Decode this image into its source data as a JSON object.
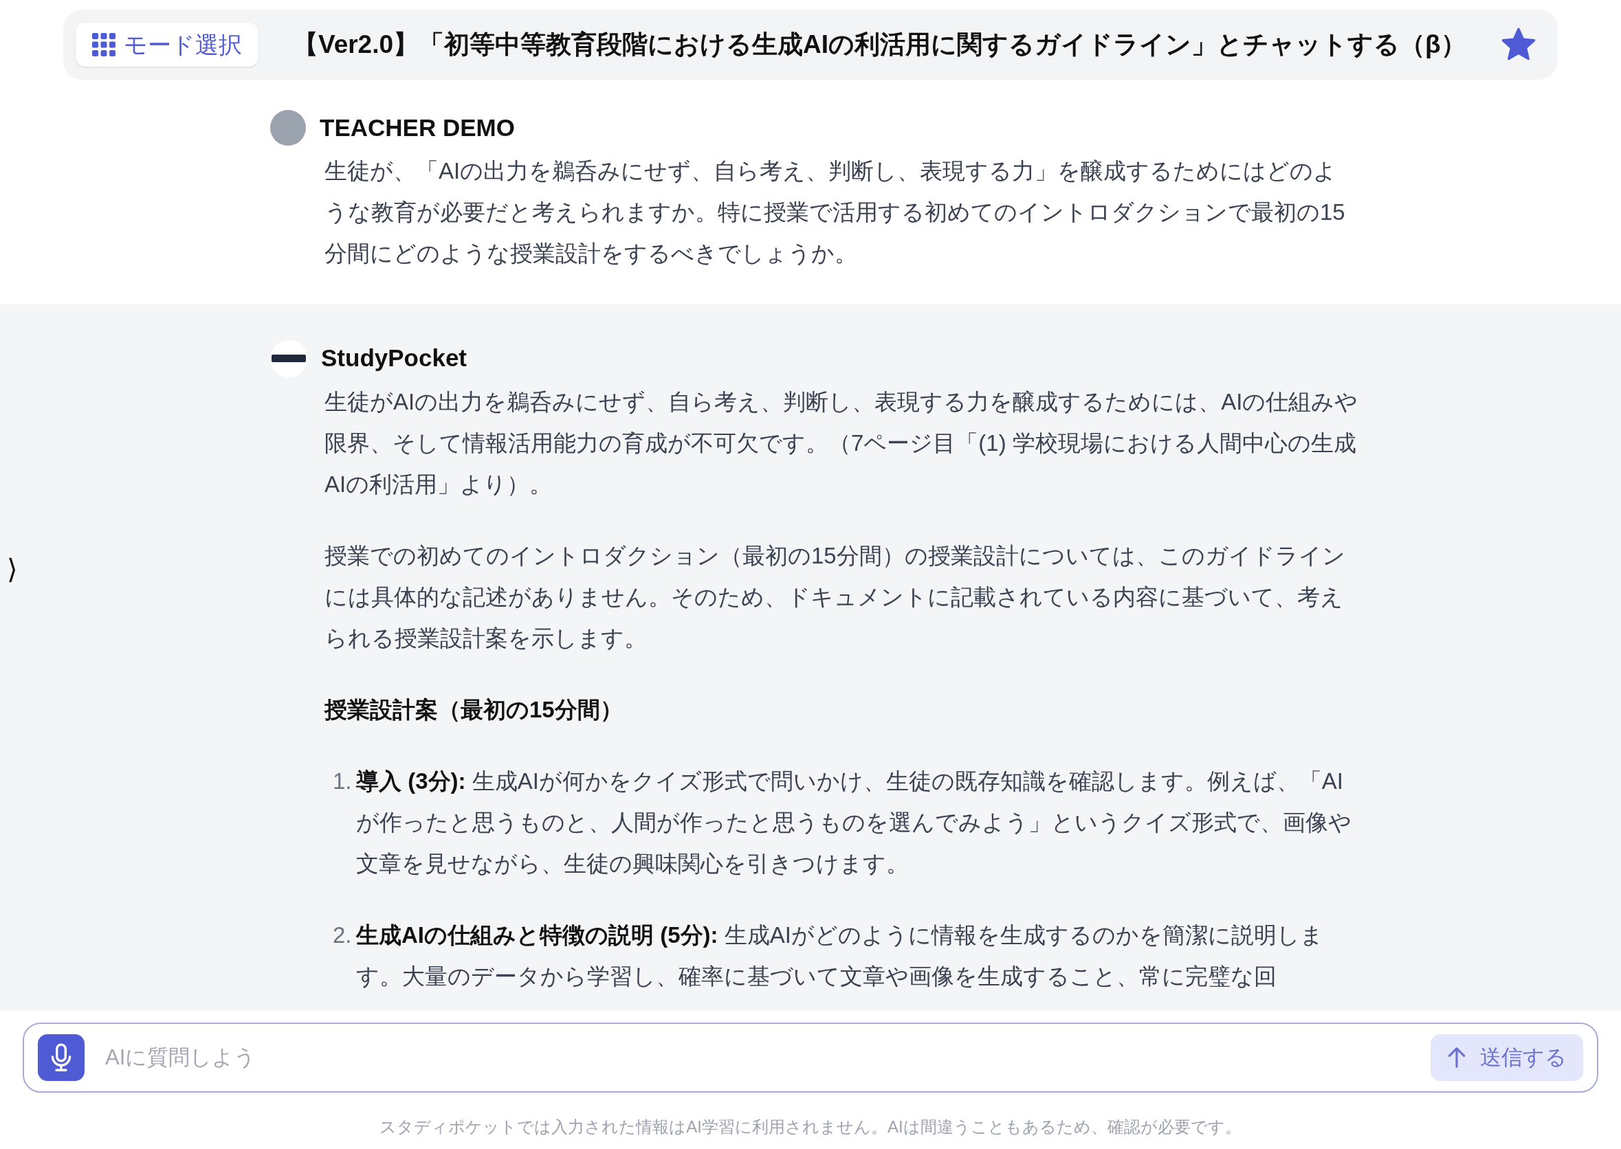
{
  "header": {
    "mode_button": "モード選択",
    "title": "【Ver2.0】「初等中等教育段階における生成AIの利活用に関するガイドライン」とチャットする（β）",
    "favorited": true
  },
  "sidebar_toggle": "⟩",
  "messages": [
    {
      "kind": "user",
      "author": "TEACHER DEMO",
      "blocks": [
        {
          "kind": "paragraph",
          "text": "生徒が、「AIの出力を鵜呑みにせず、自ら考え、判断し、表現する力」を醸成するためにはどのような教育が必要だと考えられますか。特に授業で活用する初めてのイントロダクションで最初の15分間にどのような授業設計をするべきでしょうか。"
        }
      ]
    },
    {
      "kind": "assistant",
      "author": "StudyPocket",
      "blocks": [
        {
          "kind": "paragraph",
          "text": "生徒がAIの出力を鵜呑みにせず、自ら考え、判断し、表現する力を醸成するためには、AIの仕組みや限界、そして情報活用能力の育成が不可欠です。（7ページ目「(1) 学校現場における人間中心の生成AIの利活用」より）。"
        },
        {
          "kind": "paragraph",
          "text": "授業での初めてのイントロダクション（最初の15分間）の授業設計については、このガイドラインには具体的な記述がありません。そのため、ドキュメントに記載されている内容に基づいて、考えられる授業設計案を示します。"
        },
        {
          "kind": "heading",
          "text": "授業設計案（最初の15分間）"
        },
        {
          "kind": "list_item",
          "number": "1.",
          "text": "**導入 (3分):** 生成AIが何かをクイズ形式で問いかけ、生徒の既存知識を確認します。例えば、「AIが作ったと思うものと、人間が作ったと思うものを選んでみよう」というクイズ形式で、画像や文章を見せながら、生徒の興味関心を引きつけます。"
        },
        {
          "kind": "list_item",
          "number": "2.",
          "text": "**生成AIの仕組みと特徴の説明 (5分):** 生成AIがどのように情報を生成するのかを簡潔に説明します。大量のデータから学習し、確率に基づいて文章や画像を生成すること、常に完璧な回"
        }
      ]
    }
  ],
  "composer": {
    "placeholder": "AIに質問しよう",
    "send_button": "送信する",
    "send_disabled": true
  },
  "footer_note": "スタディポケットでは入力された情報はAI学習に利用されません。AIは間違うこともあるため、確認が必要です。"
}
